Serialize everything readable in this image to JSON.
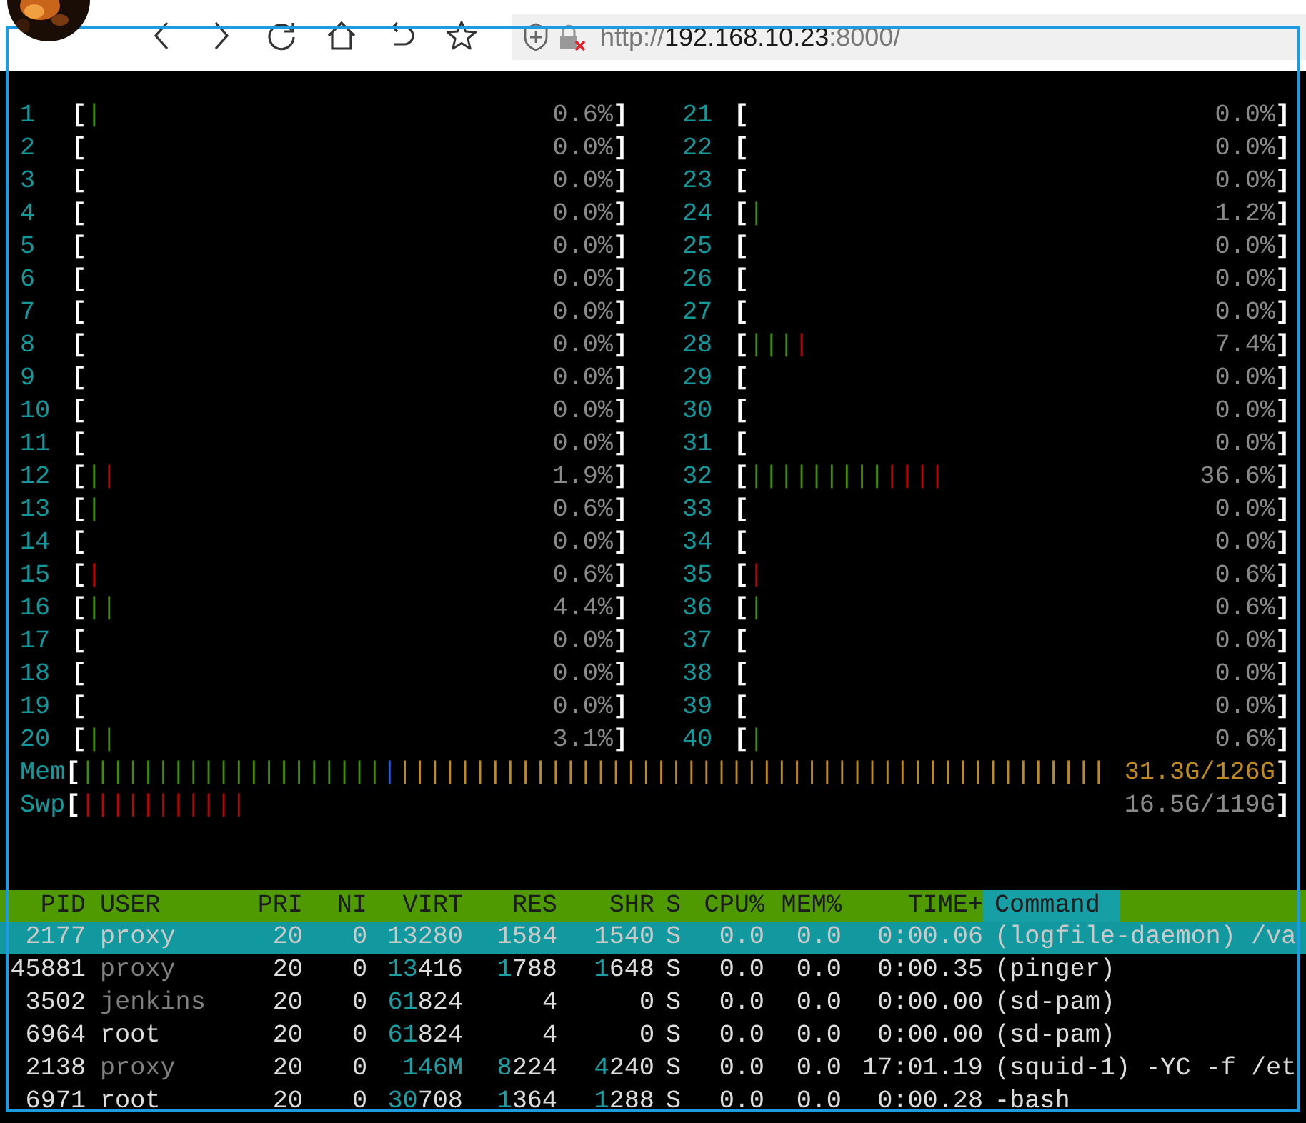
{
  "browser": {
    "url": {
      "scheme": "http://",
      "host": "192.168.10.23",
      "rest": ":8000/"
    }
  },
  "cpu_meters": [
    {
      "label": "1",
      "open": "[",
      "bar": [
        {
          "kind": "normal",
          "text": "|"
        }
      ],
      "reading": "0.6%",
      "close": "]"
    },
    {
      "label": "2",
      "open": "[",
      "reading": "0.0%",
      "close": "]"
    },
    {
      "label": "3",
      "open": "[",
      "reading": "0.0%",
      "close": "]"
    },
    {
      "label": "4",
      "open": "[",
      "reading": "0.0%",
      "close": "]"
    },
    {
      "label": "5",
      "open": "[",
      "reading": "0.0%",
      "close": "]"
    },
    {
      "label": "6",
      "open": "[",
      "reading": "0.0%",
      "close": "]"
    },
    {
      "label": "7",
      "open": "[",
      "reading": "0.0%",
      "close": "]"
    },
    {
      "label": "8",
      "open": "[",
      "reading": "0.0%",
      "close": "]"
    },
    {
      "label": "9",
      "open": "[",
      "reading": "0.0%",
      "close": "]"
    },
    {
      "label": "10",
      "open": "[",
      "reading": "0.0%",
      "close": "]"
    },
    {
      "label": "11",
      "open": "[",
      "reading": "0.0%",
      "close": "]"
    },
    {
      "label": "12",
      "open": "[",
      "bar": [
        {
          "kind": "normal",
          "text": "|"
        },
        {
          "kind": "kernel",
          "text": "|"
        }
      ],
      "reading": "1.9%",
      "close": "]"
    },
    {
      "label": "13",
      "open": "[",
      "bar": [
        {
          "kind": "normal",
          "text": "|"
        }
      ],
      "reading": "0.6%",
      "close": "]"
    },
    {
      "label": "14",
      "open": "[",
      "reading": "0.0%",
      "close": "]"
    },
    {
      "label": "15",
      "open": "[",
      "bar": [
        {
          "kind": "kernel",
          "text": "|"
        }
      ],
      "reading": "0.6%",
      "close": "]"
    },
    {
      "label": "16",
      "open": "[",
      "bar": [
        {
          "kind": "normal",
          "text": "||"
        }
      ],
      "reading": "4.4%",
      "close": "]"
    },
    {
      "label": "17",
      "open": "[",
      "reading": "0.0%",
      "close": "]"
    },
    {
      "label": "18",
      "open": "[",
      "reading": "0.0%",
      "close": "]"
    },
    {
      "label": "19",
      "open": "[",
      "reading": "0.0%",
      "close": "]"
    },
    {
      "label": "20",
      "open": "[",
      "bar": [
        {
          "kind": "normal",
          "text": "||"
        }
      ],
      "reading": "3.1%",
      "close": "]"
    },
    {
      "label": "21",
      "open": "[",
      "reading": "0.0%",
      "close": "]"
    },
    {
      "label": "22",
      "open": "[",
      "reading": "0.0%",
      "close": "]"
    },
    {
      "label": "23",
      "open": "[",
      "reading": "0.0%",
      "close": "]"
    },
    {
      "label": "24",
      "open": "[",
      "bar": [
        {
          "kind": "normal",
          "text": "|"
        }
      ],
      "reading": "1.2%",
      "close": "]"
    },
    {
      "label": "25",
      "open": "[",
      "reading": "0.0%",
      "close": "]"
    },
    {
      "label": "26",
      "open": "[",
      "reading": "0.0%",
      "close": "]"
    },
    {
      "label": "27",
      "open": "[",
      "reading": "0.0%",
      "close": "]"
    },
    {
      "label": "28",
      "open": "[",
      "bar": [
        {
          "kind": "normal",
          "text": "|||"
        },
        {
          "kind": "kernel",
          "text": "|"
        }
      ],
      "reading": "7.4%",
      "close": "]"
    },
    {
      "label": "29",
      "open": "[",
      "reading": "0.0%",
      "close": "]"
    },
    {
      "label": "30",
      "open": "[",
      "reading": "0.0%",
      "close": "]"
    },
    {
      "label": "31",
      "open": "[",
      "reading": "0.0%",
      "close": "]"
    },
    {
      "label": "32",
      "open": "[",
      "bar": [
        {
          "kind": "normal",
          "text": "|||||||||"
        },
        {
          "kind": "kernel",
          "text": "||||"
        }
      ],
      "reading": "36.6%",
      "close": "]"
    },
    {
      "label": "33",
      "open": "[",
      "reading": "0.0%",
      "close": "]"
    },
    {
      "label": "34",
      "open": "[",
      "reading": "0.0%",
      "close": "]"
    },
    {
      "label": "35",
      "open": "[",
      "bar": [
        {
          "kind": "kernel",
          "text": "|"
        }
      ],
      "reading": "0.6%",
      "close": "]"
    },
    {
      "label": "36",
      "open": "[",
      "bar": [
        {
          "kind": "normal",
          "text": "|"
        }
      ],
      "reading": "0.6%",
      "close": "]"
    },
    {
      "label": "37",
      "open": "[",
      "reading": "0.0%",
      "close": "]"
    },
    {
      "label": "38",
      "open": "[",
      "reading": "0.0%",
      "close": "]"
    },
    {
      "label": "39",
      "open": "[",
      "reading": "0.0%",
      "close": "]"
    },
    {
      "label": "40",
      "open": "[",
      "bar": [
        {
          "kind": "normal",
          "text": "|"
        }
      ],
      "reading": "0.6%",
      "close": "]"
    }
  ],
  "memory_meters": [
    {
      "label": "Mem",
      "open": "[",
      "bar": [
        {
          "kind": "normal",
          "text": "||||||||||||||||||||"
        },
        {
          "kind": "buffers",
          "text": "|"
        },
        {
          "kind": "cache",
          "text": "|||||||||||||||||||||||||||||||||||||||||||||||"
        }
      ],
      "reading": "31.3G/126G",
      "kind": "memory",
      "close": "]"
    },
    {
      "label": "Swp",
      "open": "[",
      "bar": [
        {
          "kind": "kernel",
          "text": "|||||||||||"
        }
      ],
      "reading": "16.5G/119G",
      "kind": "swap",
      "close": "]"
    }
  ],
  "process_table": {
    "columns": [
      {
        "label": "PID",
        "selected": false
      },
      {
        "label": "USER",
        "selected": false
      },
      {
        "label": "PRI",
        "selected": false
      },
      {
        "label": "NI",
        "selected": false
      },
      {
        "label": "VIRT",
        "selected": false
      },
      {
        "label": "RES",
        "selected": false
      },
      {
        "label": "SHR",
        "selected": false
      },
      {
        "label": "S",
        "selected": false
      },
      {
        "label": "CPU%",
        "selected": false
      },
      {
        "label": "MEM%",
        "selected": false
      },
      {
        "label": "TIME+",
        "selected": false
      },
      {
        "label": "Command",
        "selected": true
      }
    ],
    "rows": [
      {
        "selected": true,
        "pid": "2177",
        "user": "proxy",
        "user_dimmed": true,
        "pri": "20",
        "ni": "0",
        "virt": [
          {
            "kind": "units",
            "text": "13280"
          }
        ],
        "res": [
          {
            "kind": "units",
            "text": "1584"
          }
        ],
        "shr": [
          {
            "kind": "units",
            "text": "1540"
          }
        ],
        "state": "S",
        "cpu": "0.0",
        "mem": "0.0",
        "time": "0:00.06",
        "command": "(logfile-daemon) /va"
      },
      {
        "selected": false,
        "pid": "45881",
        "user": "proxy",
        "user_dimmed": true,
        "pri": "20",
        "ni": "0",
        "virt": [
          {
            "kind": "high",
            "text": "13"
          },
          {
            "kind": "units",
            "text": "416"
          }
        ],
        "res": [
          {
            "kind": "high",
            "text": "1"
          },
          {
            "kind": "units",
            "text": "788"
          }
        ],
        "shr": [
          {
            "kind": "high",
            "text": "1"
          },
          {
            "kind": "units",
            "text": "648"
          }
        ],
        "state": "S",
        "cpu": "0.0",
        "mem": "0.0",
        "time": "0:00.35",
        "command": "(pinger)"
      },
      {
        "selected": false,
        "pid": "3502",
        "user": "jenkins",
        "user_dimmed": true,
        "pri": "20",
        "ni": "0",
        "virt": [
          {
            "kind": "high",
            "text": "61"
          },
          {
            "kind": "units",
            "text": "824"
          }
        ],
        "res": [
          {
            "kind": "units",
            "text": "4"
          }
        ],
        "shr": [
          {
            "kind": "units",
            "text": "0"
          }
        ],
        "state": "S",
        "cpu": "0.0",
        "mem": "0.0",
        "time": "0:00.00",
        "command": "(sd-pam)"
      },
      {
        "selected": false,
        "pid": "6964",
        "user": "root",
        "user_dimmed": false,
        "pri": "20",
        "ni": "0",
        "virt": [
          {
            "kind": "high",
            "text": "61"
          },
          {
            "kind": "units",
            "text": "824"
          }
        ],
        "res": [
          {
            "kind": "units",
            "text": "4"
          }
        ],
        "shr": [
          {
            "kind": "units",
            "text": "0"
          }
        ],
        "state": "S",
        "cpu": "0.0",
        "mem": "0.0",
        "time": "0:00.00",
        "command": "(sd-pam)"
      },
      {
        "selected": false,
        "pid": "2138",
        "user": "proxy",
        "user_dimmed": true,
        "pri": "20",
        "ni": "0",
        "virt": [
          {
            "kind": "high",
            "text": "146M"
          }
        ],
        "res": [
          {
            "kind": "high",
            "text": "8"
          },
          {
            "kind": "units",
            "text": "224"
          }
        ],
        "shr": [
          {
            "kind": "high",
            "text": "4"
          },
          {
            "kind": "units",
            "text": "240"
          }
        ],
        "state": "S",
        "cpu": "0.0",
        "mem": "0.0",
        "time": "17:01.19",
        "command": "(squid-1) -YC -f /et"
      },
      {
        "selected": false,
        "pid": "6971",
        "user": "root",
        "user_dimmed": false,
        "pri": "20",
        "ni": "0",
        "virt": [
          {
            "kind": "high",
            "text": "30"
          },
          {
            "kind": "units",
            "text": "708"
          }
        ],
        "res": [
          {
            "kind": "high",
            "text": "1"
          },
          {
            "kind": "units",
            "text": "364"
          }
        ],
        "shr": [
          {
            "kind": "high",
            "text": "1"
          },
          {
            "kind": "units",
            "text": "288"
          }
        ],
        "state": "S",
        "cpu": "0.0",
        "mem": "0.0",
        "time": "0:00.28",
        "command": "-bash"
      }
    ]
  }
}
